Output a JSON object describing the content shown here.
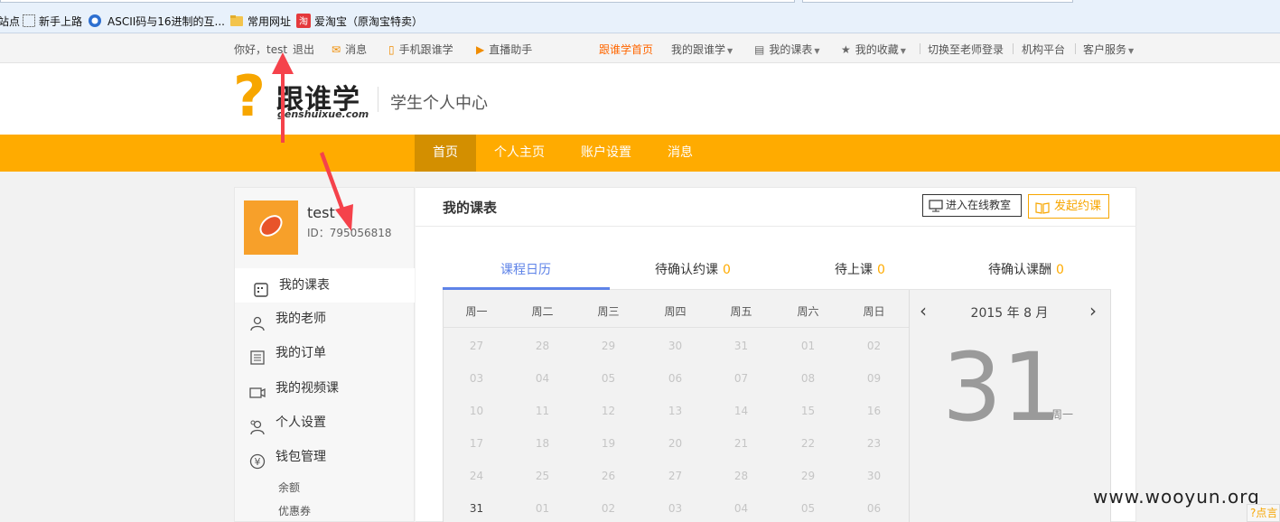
{
  "bookmarks": {
    "items": [
      {
        "label": "站点"
      },
      {
        "label": "新手上路"
      },
      {
        "label": "ASCII码与16进制的互..."
      },
      {
        "label": "常用网址"
      },
      {
        "label": "爱淘宝（原淘宝特卖）"
      }
    ]
  },
  "topnav": {
    "greeting": "你好，",
    "username": "test",
    "logout": "退出",
    "messages": "消息",
    "mobile": "手机跟谁学",
    "live": "直播助手",
    "home": "跟谁学首页",
    "my_gsx": "我的跟谁学",
    "my_schedule": "我的课表",
    "my_favorites": "我的收藏",
    "switch_teacher": "切换至老师登录",
    "org_platform": "机构平台",
    "customer_service": "客户服务"
  },
  "header": {
    "logo_mark": "?",
    "logo_text": "跟谁学",
    "logo_domain": "genshuixue.com",
    "title": "学生个人中心"
  },
  "mainnav": {
    "items": [
      {
        "label": "首页",
        "active": true
      },
      {
        "label": "个人主页",
        "active": false
      },
      {
        "label": "账户设置",
        "active": false
      },
      {
        "label": "消息",
        "active": false
      }
    ]
  },
  "profile": {
    "name": "test",
    "id_label": "ID：795056818"
  },
  "sidebar": {
    "items": [
      {
        "label": "我的课表",
        "icon": "schedule-icon",
        "active": true
      },
      {
        "label": "我的老师",
        "icon": "teacher-icon",
        "active": false
      },
      {
        "label": "我的订单",
        "icon": "order-icon",
        "active": false
      },
      {
        "label": "我的视频课",
        "icon": "video-icon",
        "active": false
      },
      {
        "label": "个人设置",
        "icon": "settings-icon",
        "active": false
      },
      {
        "label": "钱包管理",
        "icon": "wallet-icon",
        "active": false
      }
    ],
    "wallet_sub": [
      {
        "label": "余额"
      },
      {
        "label": "优惠券"
      }
    ]
  },
  "panel": {
    "title": "我的课表",
    "btn_classroom": "进入在线教室",
    "btn_invite": "发起约课"
  },
  "subtabs": [
    {
      "label": "课程日历",
      "count": "",
      "active": true
    },
    {
      "label": "待确认约课",
      "count": "0",
      "active": false
    },
    {
      "label": "待上课",
      "count": "0",
      "active": false
    },
    {
      "label": "待确认课酬",
      "count": "0",
      "active": false
    }
  ],
  "calendar": {
    "weekdays": [
      "周一",
      "周二",
      "周三",
      "周四",
      "周五",
      "周六",
      "周日"
    ],
    "weeks": [
      [
        "27",
        "28",
        "29",
        "30",
        "31",
        "01",
        "02"
      ],
      [
        "03",
        "04",
        "05",
        "06",
        "07",
        "08",
        "09"
      ],
      [
        "10",
        "11",
        "12",
        "13",
        "14",
        "15",
        "16"
      ],
      [
        "17",
        "18",
        "19",
        "20",
        "21",
        "22",
        "23"
      ],
      [
        "24",
        "25",
        "26",
        "27",
        "28",
        "29",
        "30"
      ],
      [
        "31",
        "01",
        "02",
        "03",
        "04",
        "05",
        "06"
      ]
    ],
    "current_cell": "31",
    "month_label": "2015 年 8 月",
    "prev": "‹",
    "next": "›",
    "big_day": "31",
    "big_weekday": "周一"
  },
  "watermark": "www.wooyun.org",
  "corner": "?点言",
  "colors": {
    "accent_orange": "#ffab00",
    "tab_blue": "#5e83e8",
    "arrow_red": "#f5424b"
  }
}
